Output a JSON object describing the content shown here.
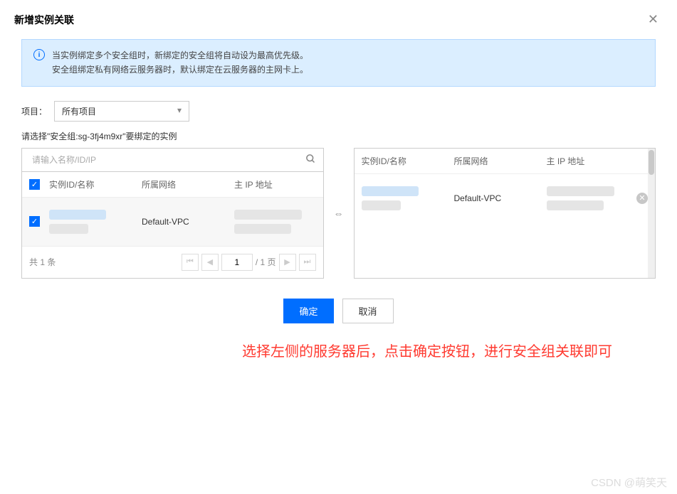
{
  "modal": {
    "title": "新增实例关联",
    "close": "✕"
  },
  "info": {
    "line1": "当实例绑定多个安全组时，新绑定的安全组将自动设为最高优先级。",
    "line2": "安全组绑定私有网络云服务器时，默认绑定在云服务器的主网卡上。"
  },
  "project": {
    "label": "项目：",
    "selected": "所有项目"
  },
  "instruction": "请选择\"安全组:sg-3fj4m9xr\"要绑定的实例",
  "search": {
    "placeholder": "请输入名称/ID/IP"
  },
  "columns": {
    "id": "实例ID/名称",
    "network": "所属网络",
    "ip": "主 IP 地址"
  },
  "rows": {
    "left": [
      {
        "network": "Default-VPC"
      }
    ],
    "right": [
      {
        "network": "Default-VPC"
      }
    ]
  },
  "pagination": {
    "total_label": "共 1 条",
    "page": "1",
    "suffix": "/ 1 页"
  },
  "annotation": "选择左侧的服务器后，点击确定按钮，进行安全组关联即可",
  "footer": {
    "confirm": "确定",
    "cancel": "取消"
  },
  "watermark": "CSDN @萌笑天"
}
